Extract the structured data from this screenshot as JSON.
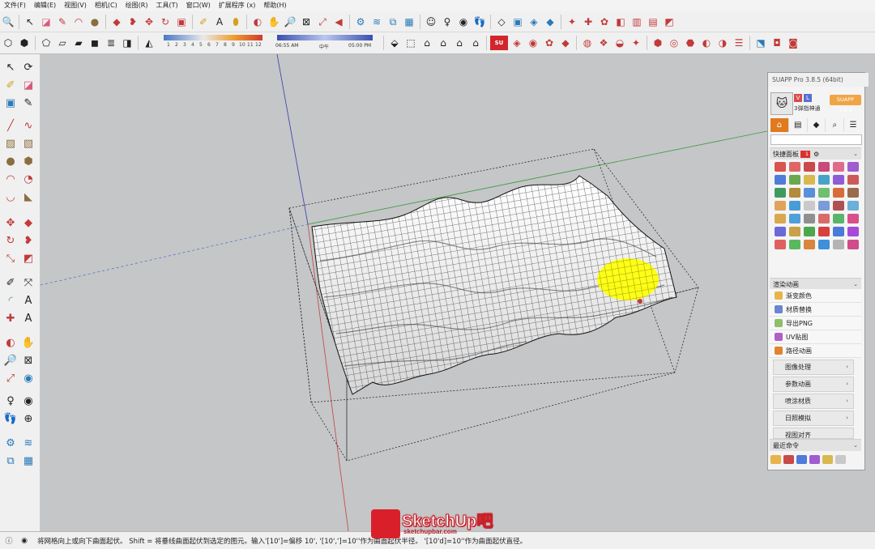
{
  "menu": [
    "文件(F)",
    "编辑(E)",
    "视图(V)",
    "相机(C)",
    "绘图(R)",
    "工具(T)",
    "窗口(W)",
    "扩展程序 (x)",
    "帮助(H)"
  ],
  "toolbar_top_icons": [
    "search-icon",
    "select-arrow-icon",
    "eraser-icon",
    "pencil-icon",
    "arc-icon",
    "circle-icon",
    "push-pull-icon",
    "follow-me-icon",
    "move-icon",
    "rotate-icon",
    "tape-measure-icon",
    "text-icon",
    "paint-bucket-icon",
    "orbit-icon",
    "pan-icon",
    "zoom-icon",
    "zoom-extents-icon",
    "zoom-window-icon",
    "sandbox-icon",
    "user-icon",
    "walk-icon",
    "section-icon",
    "component-icon",
    "material-icon"
  ],
  "shadow_bar": {
    "months": [
      "1",
      "2",
      "3",
      "4",
      "5",
      "6",
      "7",
      "8",
      "9",
      "10",
      "11",
      "12"
    ],
    "time_start": "06:55 AM",
    "time_mid": "中午",
    "time_end": "05:00 PM"
  },
  "left_toolbar_icons": [
    "select-icon",
    "lasso-icon",
    "paint-icon",
    "eraser-icon",
    "component-icon",
    "tape-icon",
    "line-icon",
    "freehand-icon",
    "rectangle-icon",
    "circle-icon",
    "polygon-icon",
    "arc-icon",
    "pie-icon",
    "push-pull-icon",
    "follow-me-icon",
    "offset-icon",
    "move-icon",
    "rotate-icon",
    "scale-icon",
    "tape-measure-icon",
    "dimension-icon",
    "protractor-icon",
    "text-icon",
    "axes-icon",
    "3d-text-icon",
    "orbit-icon",
    "pan-icon",
    "zoom-icon",
    "zoom-window-icon",
    "zoom-extents-icon",
    "position-camera-icon",
    "look-around-icon",
    "walk-icon",
    "section-plane-icon",
    "sandbox-from-contours-icon",
    "sandbox-from-scratch-icon",
    "smoove-icon",
    "stamp-icon"
  ],
  "suapp": {
    "title": "SUAPP Pro 3.8.5 (64bit)",
    "user": "3弹指神通",
    "version_badge": "SUAPP 3.8.5",
    "quick_panel": "快捷面板",
    "quick_badge": "1",
    "render_section": "渲染动画",
    "render_items": [
      {
        "label": "渐变颜色",
        "color": "#e9b34a"
      },
      {
        "label": "材质替换",
        "color": "#6b84d3"
      },
      {
        "label": "导出PNG",
        "color": "#8fbf6a"
      },
      {
        "label": "UV贴图",
        "color": "#b15ec6"
      },
      {
        "label": "路径动画",
        "color": "#e0842d"
      }
    ],
    "sub_items": [
      "图像处理",
      "参数动画",
      "喷涂材质",
      "日照模拟",
      "视图对齐"
    ],
    "recent": "最近命令",
    "grid_colors": [
      "#d9534f",
      "#e06666",
      "#c94a4a",
      "#c84b7a",
      "#e06a8c",
      "#a05dd0",
      "#4f7bd9",
      "#6aa84f",
      "#d9b84f",
      "#48a3c8",
      "#8f5cd6",
      "#cc5a5a",
      "#3d9b5f",
      "#b38b3a",
      "#5a8fd9",
      "#6fbf6f",
      "#d96b3a",
      "#9a6b4b",
      "#e0a35a",
      "#4a9cd6",
      "#c9c9c9",
      "#7c9bd9",
      "#b05050",
      "#6ab0d9",
      "#d9a84f",
      "#4f9fd9",
      "#8f8f8f",
      "#d96a6a",
      "#5ab56a",
      "#d94f8a",
      "#6a6ad9",
      "#c9a14a",
      "#4aa84a",
      "#d93f3f",
      "#4a7ad9",
      "#a84ad9",
      "#e06060",
      "#5cb85c",
      "#d9843f",
      "#3f8fd9",
      "#b4b4b4",
      "#d14a8a"
    ]
  },
  "status_text": "将网格向上或向下曲面起伏。 Shift = 将垂线曲面起伏到选定的图元。输入'[10']=偏移 10', '[10',']=10''作为曲面起伏半径。 '[10'd]=10''作为曲面起伏直径。",
  "logo": {
    "text": "SketchUp吧",
    "sub": "sketchupbar.com"
  }
}
